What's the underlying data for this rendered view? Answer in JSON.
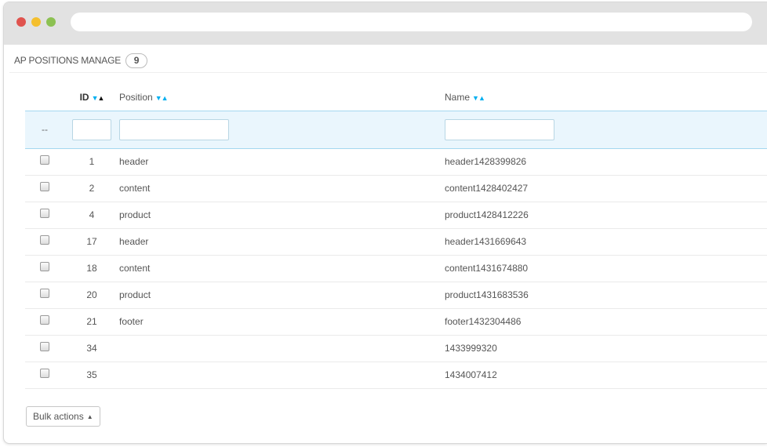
{
  "panel": {
    "title": "AP POSITIONS MANAGE",
    "count": "9"
  },
  "table": {
    "columns": {
      "id": "ID",
      "position": "Position",
      "name": "Name"
    },
    "filter_placeholder_cell": "--",
    "rows": [
      {
        "id": "1",
        "position": "header",
        "name": "header1428399826"
      },
      {
        "id": "2",
        "position": "content",
        "name": "content1428402427"
      },
      {
        "id": "4",
        "position": "product",
        "name": "product1428412226"
      },
      {
        "id": "17",
        "position": "header",
        "name": "header1431669643"
      },
      {
        "id": "18",
        "position": "content",
        "name": "content1431674880"
      },
      {
        "id": "20",
        "position": "product",
        "name": "product1431683536"
      },
      {
        "id": "21",
        "position": "footer",
        "name": "footer1432304486"
      },
      {
        "id": "34",
        "position": "",
        "name": "1433999320"
      },
      {
        "id": "35",
        "position": "",
        "name": "1434007412"
      }
    ]
  },
  "bulk_actions": {
    "label": "Bulk actions"
  },
  "icons": {
    "sort_desc": "sort-desc-icon",
    "sort_asc": "sort-asc-icon",
    "caret_up": "caret-up-icon"
  },
  "colors": {
    "accent": "#00aff0",
    "filter_row_bg": "#eaf6fd",
    "titlebar": "#e2e2e2"
  }
}
